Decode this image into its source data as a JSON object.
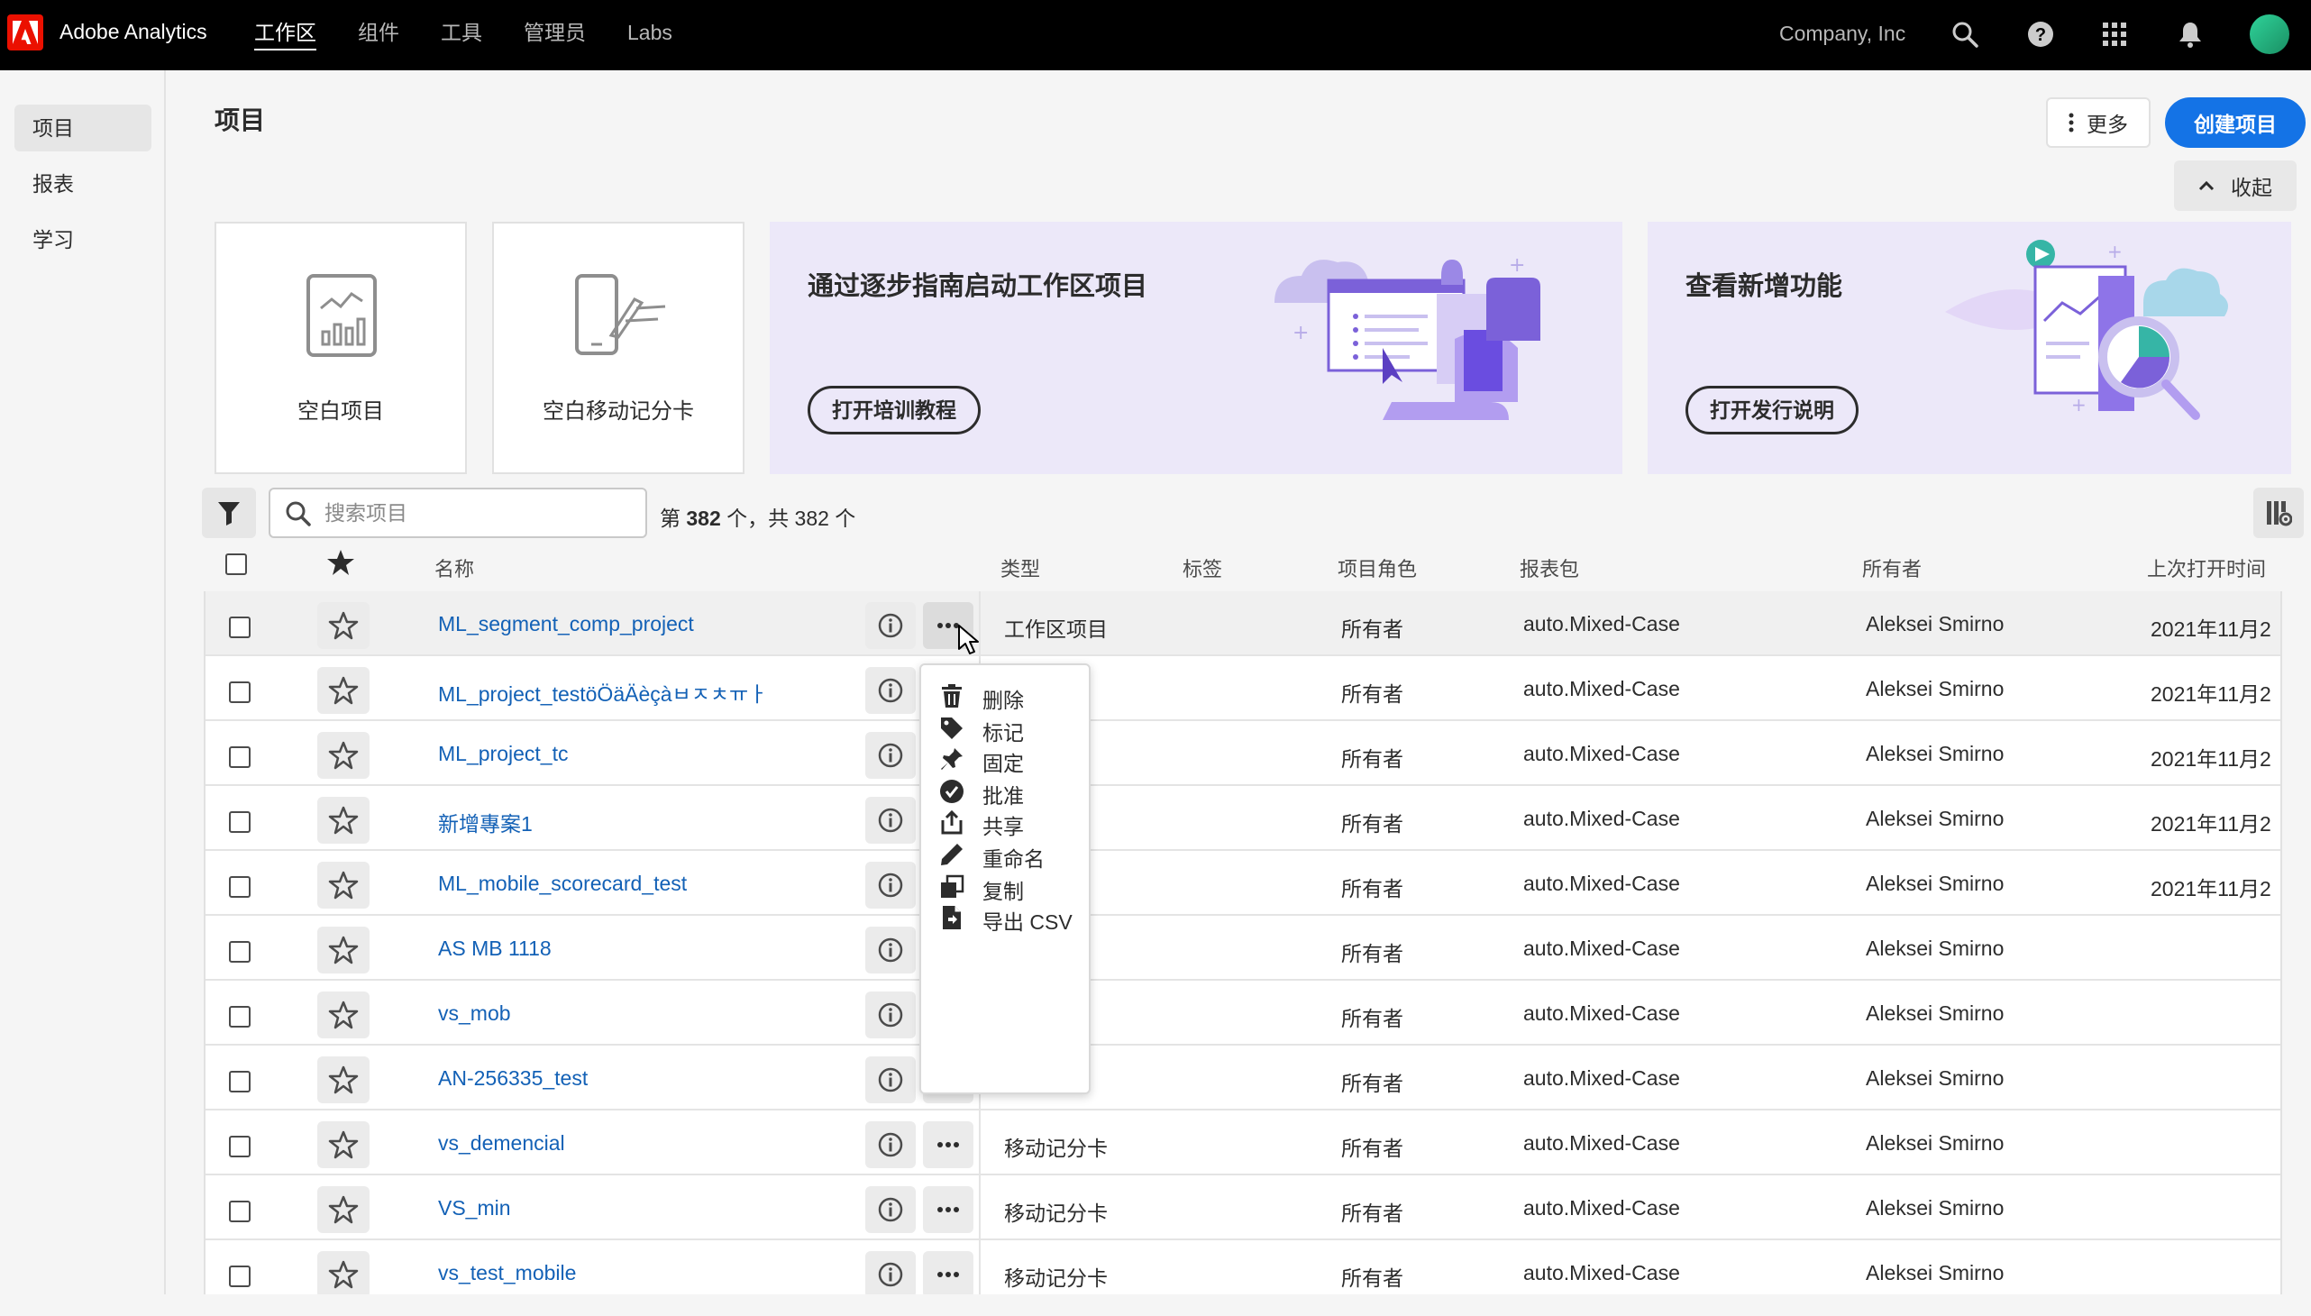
{
  "app": {
    "name": "Adobe Analytics",
    "company": "Company, Inc"
  },
  "nav": [
    "工作区",
    "组件",
    "工具",
    "管理员",
    "Labs"
  ],
  "sidebar": {
    "items": [
      "项目",
      "报表",
      "学习"
    ]
  },
  "page": {
    "title": "项目",
    "more_label": "更多",
    "create_label": "创建项目",
    "collapse_label": "收起"
  },
  "cards": {
    "blank_project": "空白项目",
    "blank_mobile": "空白移动记分卡"
  },
  "promos": [
    {
      "title": "通过逐步指南启动工作区项目",
      "button": "打开培训教程"
    },
    {
      "title": "查看新增功能",
      "button": "打开发行说明"
    }
  ],
  "toolbar": {
    "search_placeholder": "搜索项目",
    "count_prefix": "第 ",
    "count_shown": "382",
    "count_suffix": " 个，共 382 个"
  },
  "columns": {
    "name": "名称",
    "type": "类型",
    "tags": "标签",
    "role": "项目角色",
    "suite": "报表包",
    "owner": "所有者",
    "last_opened": "上次打开时间"
  },
  "rows": [
    {
      "name": "ML_segment_comp_project",
      "type": "工作区项目",
      "role": "所有者",
      "suite": "auto.Mixed-Case",
      "owner": "Aleksei Smirno",
      "date": "2021年11月2"
    },
    {
      "name": "ML_project_testöÖäÄèçàㅂㅈㅊㅠㅏ",
      "type": "目",
      "role": "所有者",
      "suite": "auto.Mixed-Case",
      "owner": "Aleksei Smirno",
      "date": "2021年11月2"
    },
    {
      "name": "ML_project_tc",
      "type": "目",
      "role": "所有者",
      "suite": "auto.Mixed-Case",
      "owner": "Aleksei Smirno",
      "date": "2021年11月2"
    },
    {
      "name": "新增專案1",
      "type": "目",
      "role": "所有者",
      "suite": "auto.Mixed-Case",
      "owner": "Aleksei Smirno",
      "date": "2021年11月2"
    },
    {
      "name": "ML_mobile_scorecard_test",
      "type": "卡",
      "role": "所有者",
      "suite": "auto.Mixed-Case",
      "owner": "Aleksei Smirno",
      "date": "2021年11月2"
    },
    {
      "name": "AS MB 1118",
      "type": "卡",
      "role": "所有者",
      "suite": "auto.Mixed-Case",
      "owner": "Aleksei Smirno",
      "date": ""
    },
    {
      "name": "vs_mob",
      "type": "卡",
      "role": "所有者",
      "suite": "auto.Mixed-Case",
      "owner": "Aleksei Smirno",
      "date": ""
    },
    {
      "name": "AN-256335_test",
      "type": "卡",
      "role": "所有者",
      "suite": "auto.Mixed-Case",
      "owner": "Aleksei Smirno",
      "date": ""
    },
    {
      "name": "vs_demencial",
      "type": "移动记分卡",
      "role": "所有者",
      "suite": "auto.Mixed-Case",
      "owner": "Aleksei Smirno",
      "date": ""
    },
    {
      "name": "VS_min",
      "type": "移动记分卡",
      "role": "所有者",
      "suite": "auto.Mixed-Case",
      "owner": "Aleksei Smirno",
      "date": ""
    },
    {
      "name": "vs_test_mobile",
      "type": "移动记分卡",
      "role": "所有者",
      "suite": "auto.Mixed-Case",
      "owner": "Aleksei Smirno",
      "date": ""
    }
  ],
  "context_menu": [
    {
      "label": "删除",
      "icon": "trash-icon"
    },
    {
      "label": "标记",
      "icon": "tag-icon"
    },
    {
      "label": "固定",
      "icon": "pin-icon"
    },
    {
      "label": "批准",
      "icon": "checkmark-circle-icon"
    },
    {
      "label": "共享",
      "icon": "share-icon"
    },
    {
      "label": "重命名",
      "icon": "pencil-icon"
    },
    {
      "label": "复制",
      "icon": "duplicate-icon"
    },
    {
      "label": "导出 CSV",
      "icon": "export-file-icon"
    }
  ],
  "colors": {
    "accent": "#1473e6",
    "link": "#1361b6",
    "topbar": "#000000",
    "promo_bg": "#ece8f9",
    "adobe_red": "#eb1000"
  }
}
